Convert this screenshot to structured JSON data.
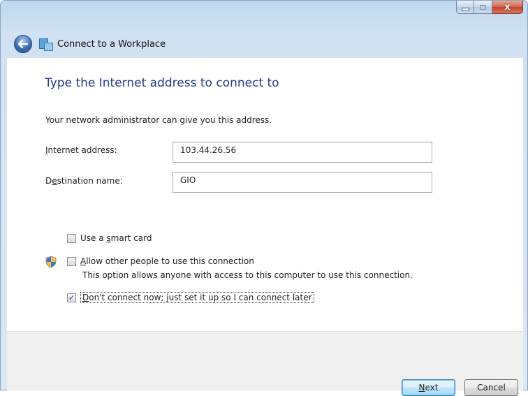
{
  "window": {
    "title": "Connect to a Workplace",
    "controls": {
      "minimize": "minimize",
      "maximize": "maximize",
      "close": "x"
    }
  },
  "page": {
    "instruction": "Type the Internet address to connect to",
    "subtext": "Your network administrator can give you this address."
  },
  "form": {
    "internet_address": {
      "label_key": "I",
      "label_rest": "nternet address:",
      "value": "103.44.26.56"
    },
    "destination_name": {
      "label_pre": "D",
      "label_key": "e",
      "label_rest": "stination name:",
      "value": "GIO"
    }
  },
  "options": {
    "smart_card": {
      "pre": "Use a ",
      "key": "s",
      "rest": "mart card",
      "checked": false
    },
    "allow_others": {
      "pre": "",
      "key": "A",
      "rest": "llow other people to use this connection",
      "checked": false,
      "description": "This option allows anyone with access to this computer to use this connection."
    },
    "connect_later": {
      "pre": "",
      "key": "D",
      "rest": "on't connect now; just set it up so I can connect later",
      "checked": true,
      "check_glyph": "✓"
    }
  },
  "buttons": {
    "next": {
      "key": "N",
      "rest": "ext"
    },
    "cancel": "Cancel"
  },
  "colors": {
    "heading": "#1f3c8c",
    "chrome": "#cfe1f2",
    "footer": "#f0f0f0"
  }
}
